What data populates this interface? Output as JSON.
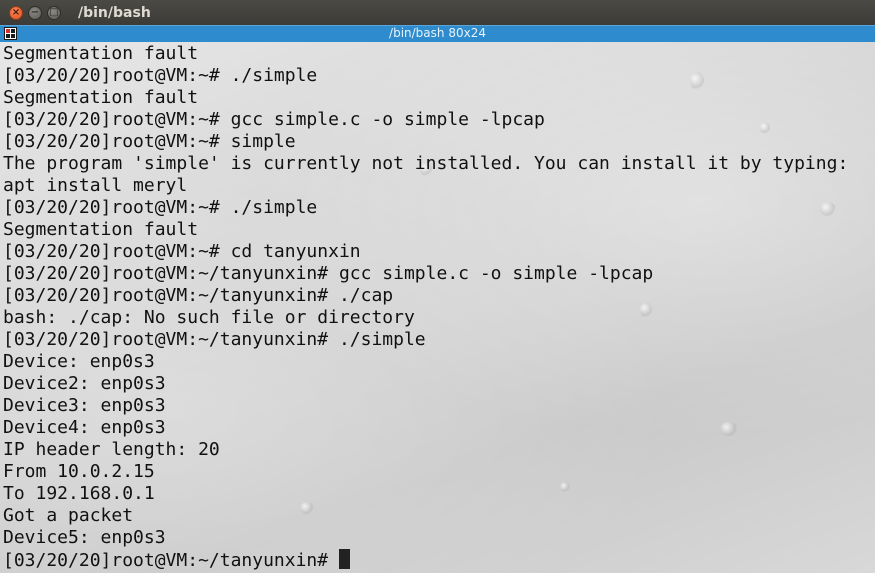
{
  "window": {
    "title": "/bin/bash",
    "close_glyph": "×",
    "minimize_glyph": "−",
    "maximize_glyph": "□"
  },
  "tab": {
    "title": "/bin/bash 80x24",
    "icon": "terminal-split-icon"
  },
  "colors": {
    "tab_bar": "#2e8bcd",
    "title_bar": "#3c3b37",
    "close_button": "#e4521c",
    "terminal_text": "#111111"
  },
  "terminal": {
    "lines": [
      "Segmentation fault",
      "[03/20/20]root@VM:~# ./simple",
      "Segmentation fault",
      "[03/20/20]root@VM:~# gcc simple.c -o simple -lpcap",
      "[03/20/20]root@VM:~# simple",
      "The program 'simple' is currently not installed. You can install it by typing:",
      "apt install meryl",
      "[03/20/20]root@VM:~# ./simple",
      "Segmentation fault",
      "[03/20/20]root@VM:~# cd tanyunxin",
      "[03/20/20]root@VM:~/tanyunxin# gcc simple.c -o simple -lpcap",
      "[03/20/20]root@VM:~/tanyunxin# ./cap",
      "bash: ./cap: No such file or directory",
      "[03/20/20]root@VM:~/tanyunxin# ./simple",
      "Device: enp0s3",
      "Device2: enp0s3",
      "Device3: enp0s3",
      "Device4: enp0s3",
      "IP header length: 20",
      "From 10.0.2.15",
      "To 192.168.0.1",
      "Got a packet",
      "Device5: enp0s3"
    ],
    "prompt": "[03/20/20]root@VM:~/tanyunxin# "
  }
}
